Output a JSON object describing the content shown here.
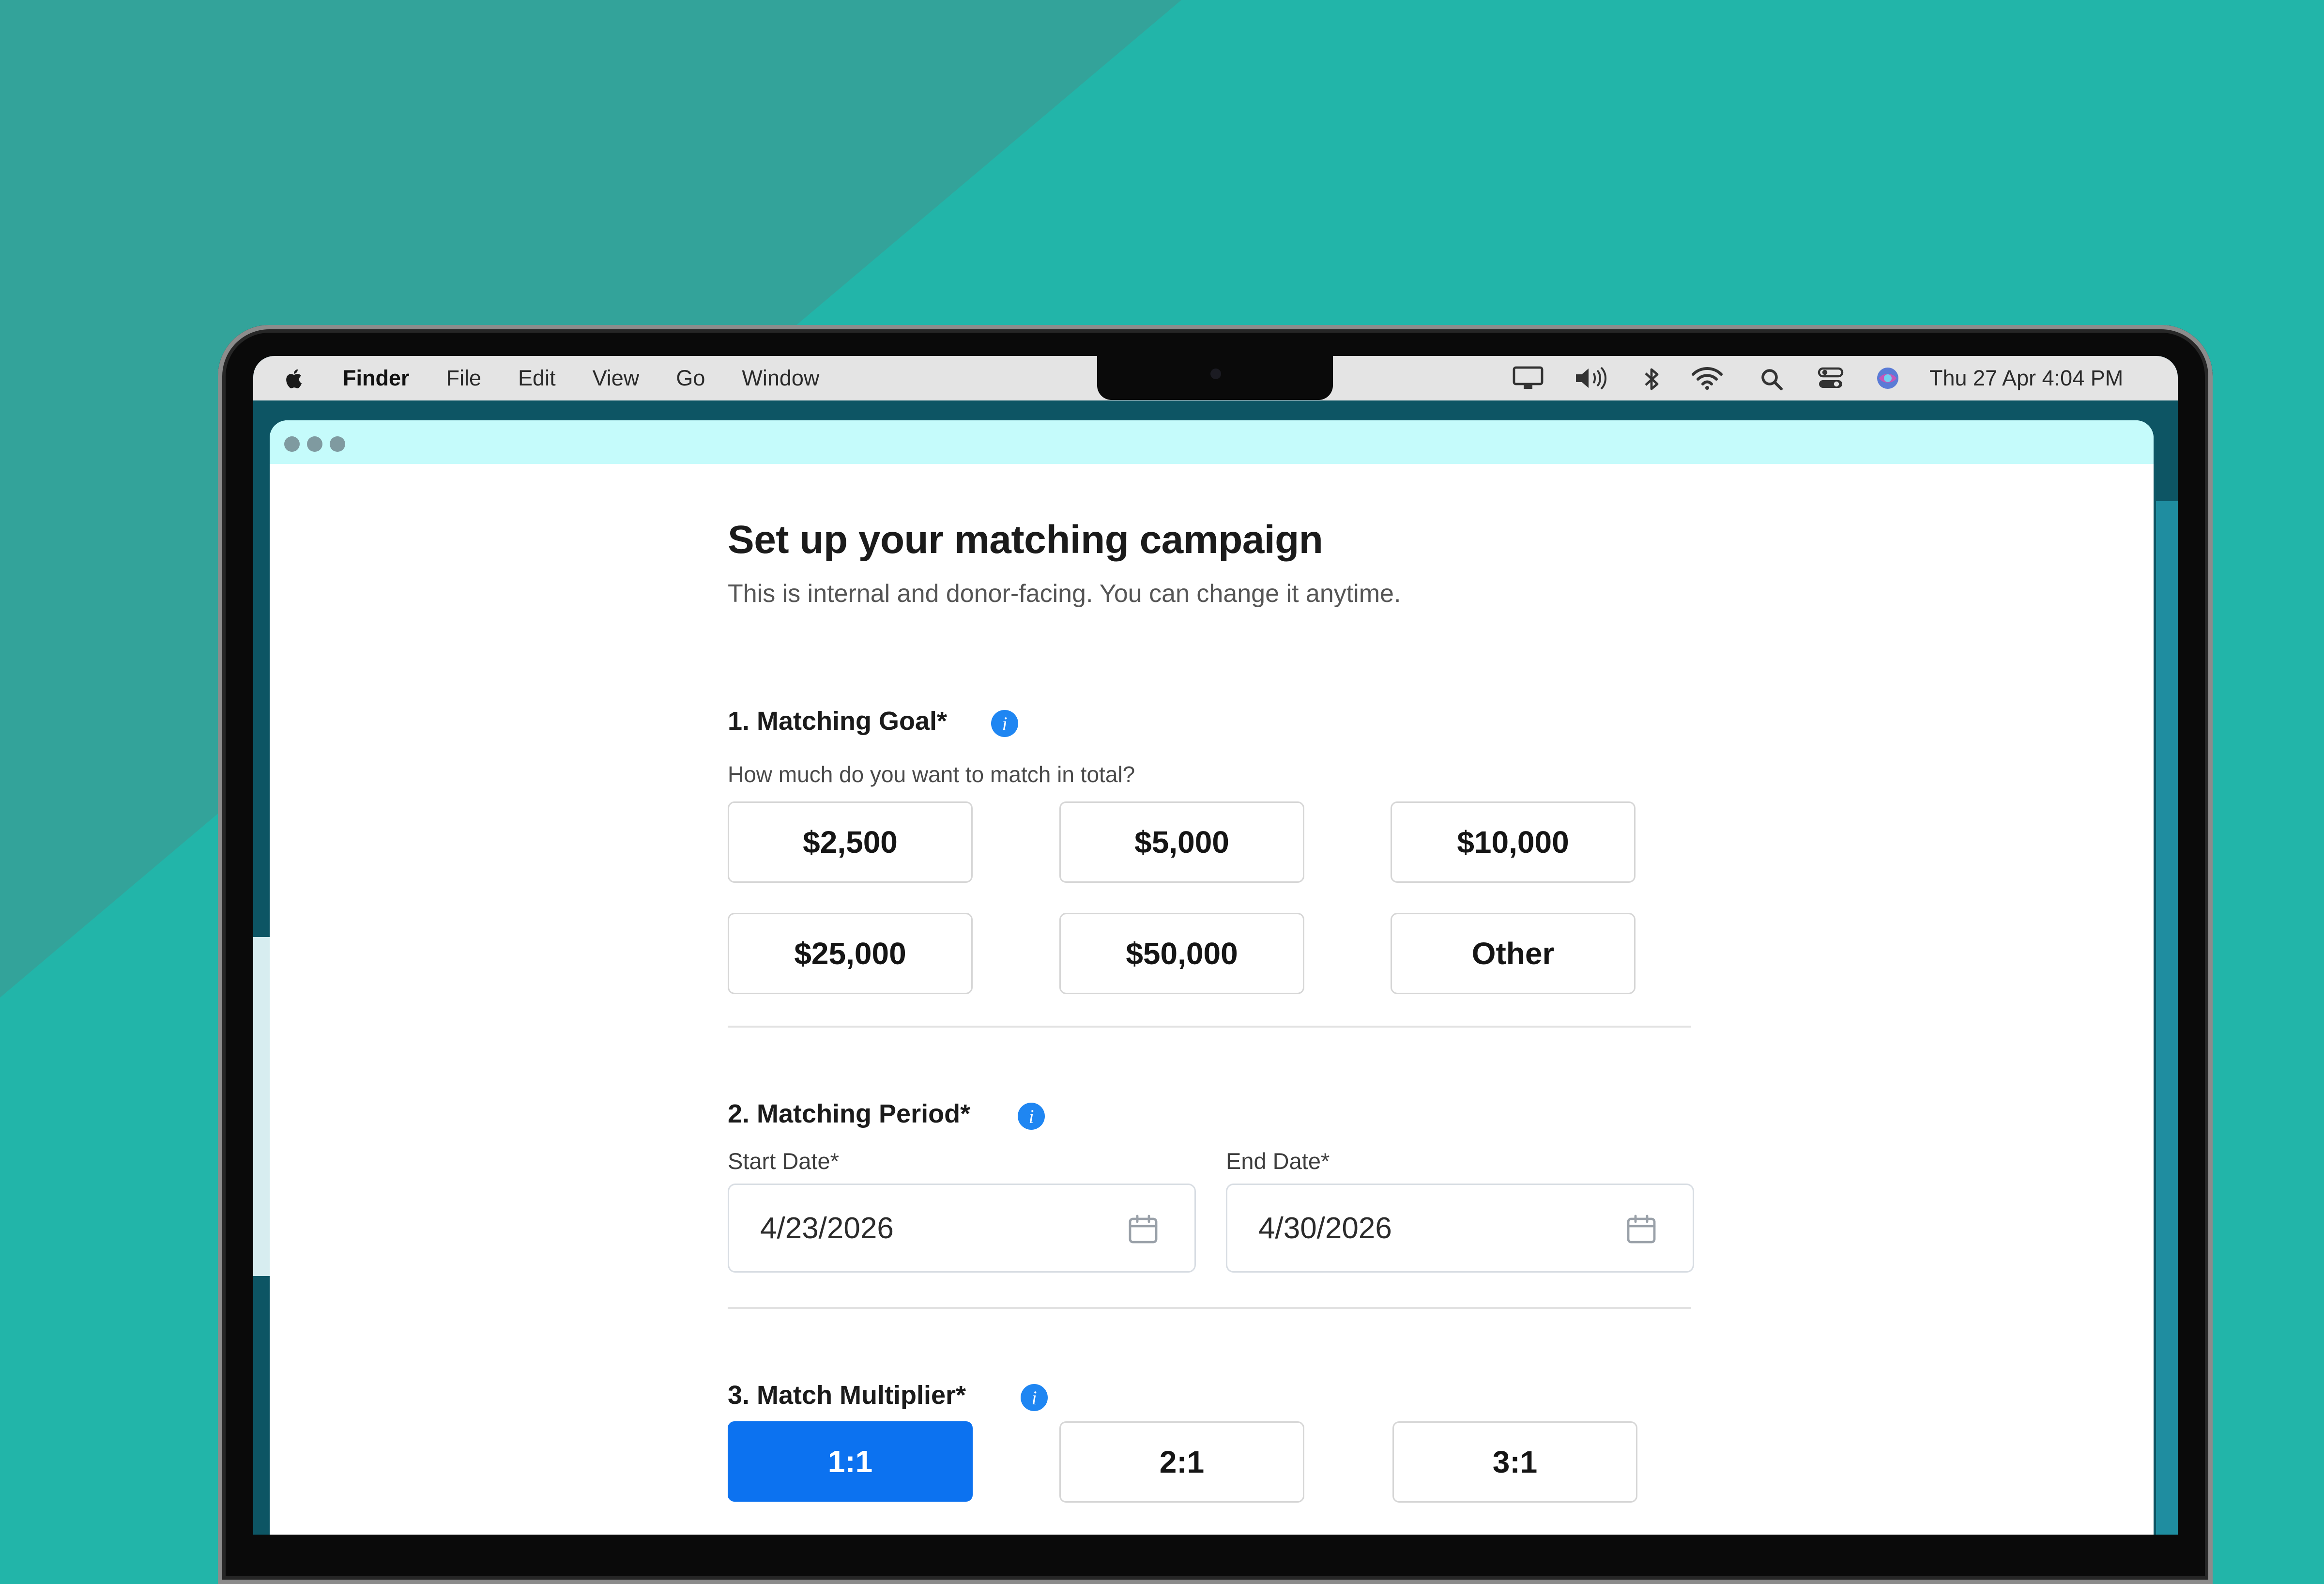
{
  "menubar": {
    "app_name": "Finder",
    "menus": [
      "File",
      "Edit",
      "View",
      "Go",
      "Window"
    ],
    "status_icons": [
      "display-icon",
      "volume-icon",
      "bluetooth-icon",
      "wifi-icon",
      "search-icon",
      "control-center-icon",
      "siri-icon"
    ],
    "clock": "Thu 27 Apr  4:04 PM"
  },
  "page": {
    "title": "Set up your matching campaign",
    "subtitle": "This is internal and donor-facing. You can change it anytime."
  },
  "goal": {
    "heading": "1. Matching Goal*",
    "hint": "How much do you want to match in total?",
    "options": [
      "$2,500",
      "$5,000",
      "$10,000",
      "$25,000",
      "$50,000",
      "Other"
    ]
  },
  "period": {
    "heading": "2. Matching Period*",
    "start_label": "Start Date*",
    "start_value": "4/23/2026",
    "end_label": "End Date*",
    "end_value": "4/30/2026"
  },
  "multiplier": {
    "heading": "3. Match Multiplier*",
    "options": [
      "1:1",
      "2:1",
      "3:1"
    ],
    "selected": "1:1"
  },
  "colors": {
    "background": "#22b5a9",
    "accent": "#0c72f0",
    "info": "#1f86f2",
    "titlebar": "#c5fbfb"
  }
}
